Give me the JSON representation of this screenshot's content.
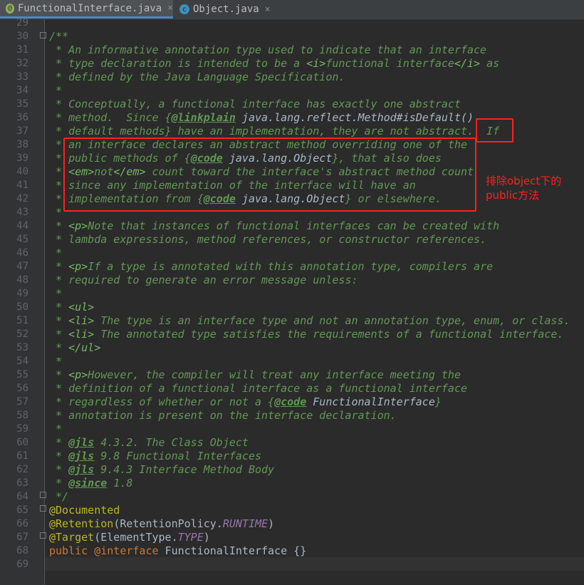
{
  "tabs": [
    {
      "label": "FunctionalInterface.java",
      "icon": "@",
      "color": "#8fb25d",
      "active": true
    },
    {
      "label": "Object.java",
      "icon": "c",
      "color": "#3d8ebf",
      "active": false
    }
  ],
  "close_glyph": "×",
  "first_line_number": 29,
  "lines": [
    [],
    [
      [
        "c",
        "/**"
      ]
    ],
    [
      [
        "c",
        " * An informative annotation type used to indicate that an interface"
      ]
    ],
    [
      [
        "c",
        " * type declaration is intended to be a "
      ],
      [
        "h",
        "<i>"
      ],
      [
        "c",
        "functional interface"
      ],
      [
        "h",
        "</i>"
      ],
      [
        "c",
        " as"
      ]
    ],
    [
      [
        "c",
        " * defined by the Java Language Specification."
      ]
    ],
    [
      [
        "c",
        " *"
      ]
    ],
    [
      [
        "c",
        " * Conceptually, a functional interface has exactly one abstract"
      ]
    ],
    [
      [
        "c",
        " * method.  Since {"
      ],
      [
        "t",
        "@linkplain"
      ],
      [
        "r",
        " java.lang.reflect.Method#isDefault()"
      ]
    ],
    [
      [
        "c",
        " * default methods} have an implementation, they are not abstract.  If"
      ]
    ],
    [
      [
        "c",
        " * an interface declares an abstract method overriding one of the"
      ]
    ],
    [
      [
        "c",
        " * public methods of {"
      ],
      [
        "t",
        "@code"
      ],
      [
        "r",
        " java.lang.Object"
      ],
      [
        "c",
        "}, that also does"
      ]
    ],
    [
      [
        "c",
        " * "
      ],
      [
        "h",
        "<em>"
      ],
      [
        "c",
        "not"
      ],
      [
        "h",
        "</em>"
      ],
      [
        "c",
        " count toward the interface's abstract method count"
      ]
    ],
    [
      [
        "c",
        " * since any implementation of the interface will have an"
      ]
    ],
    [
      [
        "c",
        " * implementation from {"
      ],
      [
        "t",
        "@code"
      ],
      [
        "r",
        " java.lang.Object"
      ],
      [
        "c",
        "} or elsewhere."
      ]
    ],
    [
      [
        "c",
        " *"
      ]
    ],
    [
      [
        "c",
        " * "
      ],
      [
        "h",
        "<p>"
      ],
      [
        "c",
        "Note that instances of functional interfaces can be created with"
      ]
    ],
    [
      [
        "c",
        " * lambda expressions, method references, or constructor references."
      ]
    ],
    [
      [
        "c",
        " *"
      ]
    ],
    [
      [
        "c",
        " * "
      ],
      [
        "h",
        "<p>"
      ],
      [
        "c",
        "If a type is annotated with this annotation type, compilers are"
      ]
    ],
    [
      [
        "c",
        " * required to generate an error message unless:"
      ]
    ],
    [
      [
        "c",
        " *"
      ]
    ],
    [
      [
        "c",
        " * "
      ],
      [
        "h",
        "<ul>"
      ]
    ],
    [
      [
        "c",
        " * "
      ],
      [
        "h",
        "<li>"
      ],
      [
        "c",
        " The type is an interface type and not an annotation type, enum, or class."
      ]
    ],
    [
      [
        "c",
        " * "
      ],
      [
        "h",
        "<li>"
      ],
      [
        "c",
        " The annotated type satisfies the requirements of a functional interface."
      ]
    ],
    [
      [
        "c",
        " * "
      ],
      [
        "h",
        "</ul>"
      ]
    ],
    [
      [
        "c",
        " *"
      ]
    ],
    [
      [
        "c",
        " * "
      ],
      [
        "h",
        "<p>"
      ],
      [
        "c",
        "However, the compiler will treat any interface meeting the"
      ]
    ],
    [
      [
        "c",
        " * definition of a functional interface as a functional interface"
      ]
    ],
    [
      [
        "c",
        " * regardless of whether or not a {"
      ],
      [
        "t",
        "@code"
      ],
      [
        "r",
        " FunctionalInterface"
      ],
      [
        "c",
        "}"
      ]
    ],
    [
      [
        "c",
        " * annotation is present on the interface declaration."
      ]
    ],
    [
      [
        "c",
        " *"
      ]
    ],
    [
      [
        "c",
        " * "
      ],
      [
        "t",
        "@jls"
      ],
      [
        "c",
        " 4.3.2. The Class Object"
      ]
    ],
    [
      [
        "c",
        " * "
      ],
      [
        "t",
        "@jls"
      ],
      [
        "c",
        " 9.8 Functional Interfaces"
      ]
    ],
    [
      [
        "c",
        " * "
      ],
      [
        "t",
        "@jls"
      ],
      [
        "c",
        " 9.4.3 Interface Method Body"
      ]
    ],
    [
      [
        "c",
        " * "
      ],
      [
        "t",
        "@since"
      ],
      [
        "c",
        " 1.8"
      ]
    ],
    [
      [
        "c",
        " */"
      ]
    ],
    [
      [
        "a",
        "@Documented"
      ]
    ],
    [
      [
        "a",
        "@Retention"
      ],
      [
        "n",
        "(RetentionPolicy."
      ],
      [
        "s",
        "RUNTIME"
      ],
      [
        "n",
        ")"
      ]
    ],
    [
      [
        "a",
        "@Target"
      ],
      [
        "n",
        "(ElementType."
      ],
      [
        "s",
        "TYPE"
      ],
      [
        "n",
        ")"
      ]
    ],
    [
      [
        "k",
        "public "
      ],
      [
        "k",
        "@interface "
      ],
      [
        "n",
        "FunctionalInterface {}"
      ]
    ],
    []
  ],
  "annotation_note": [
    "排除object下的",
    "public方法"
  ],
  "highlight_color": "#ff2020"
}
